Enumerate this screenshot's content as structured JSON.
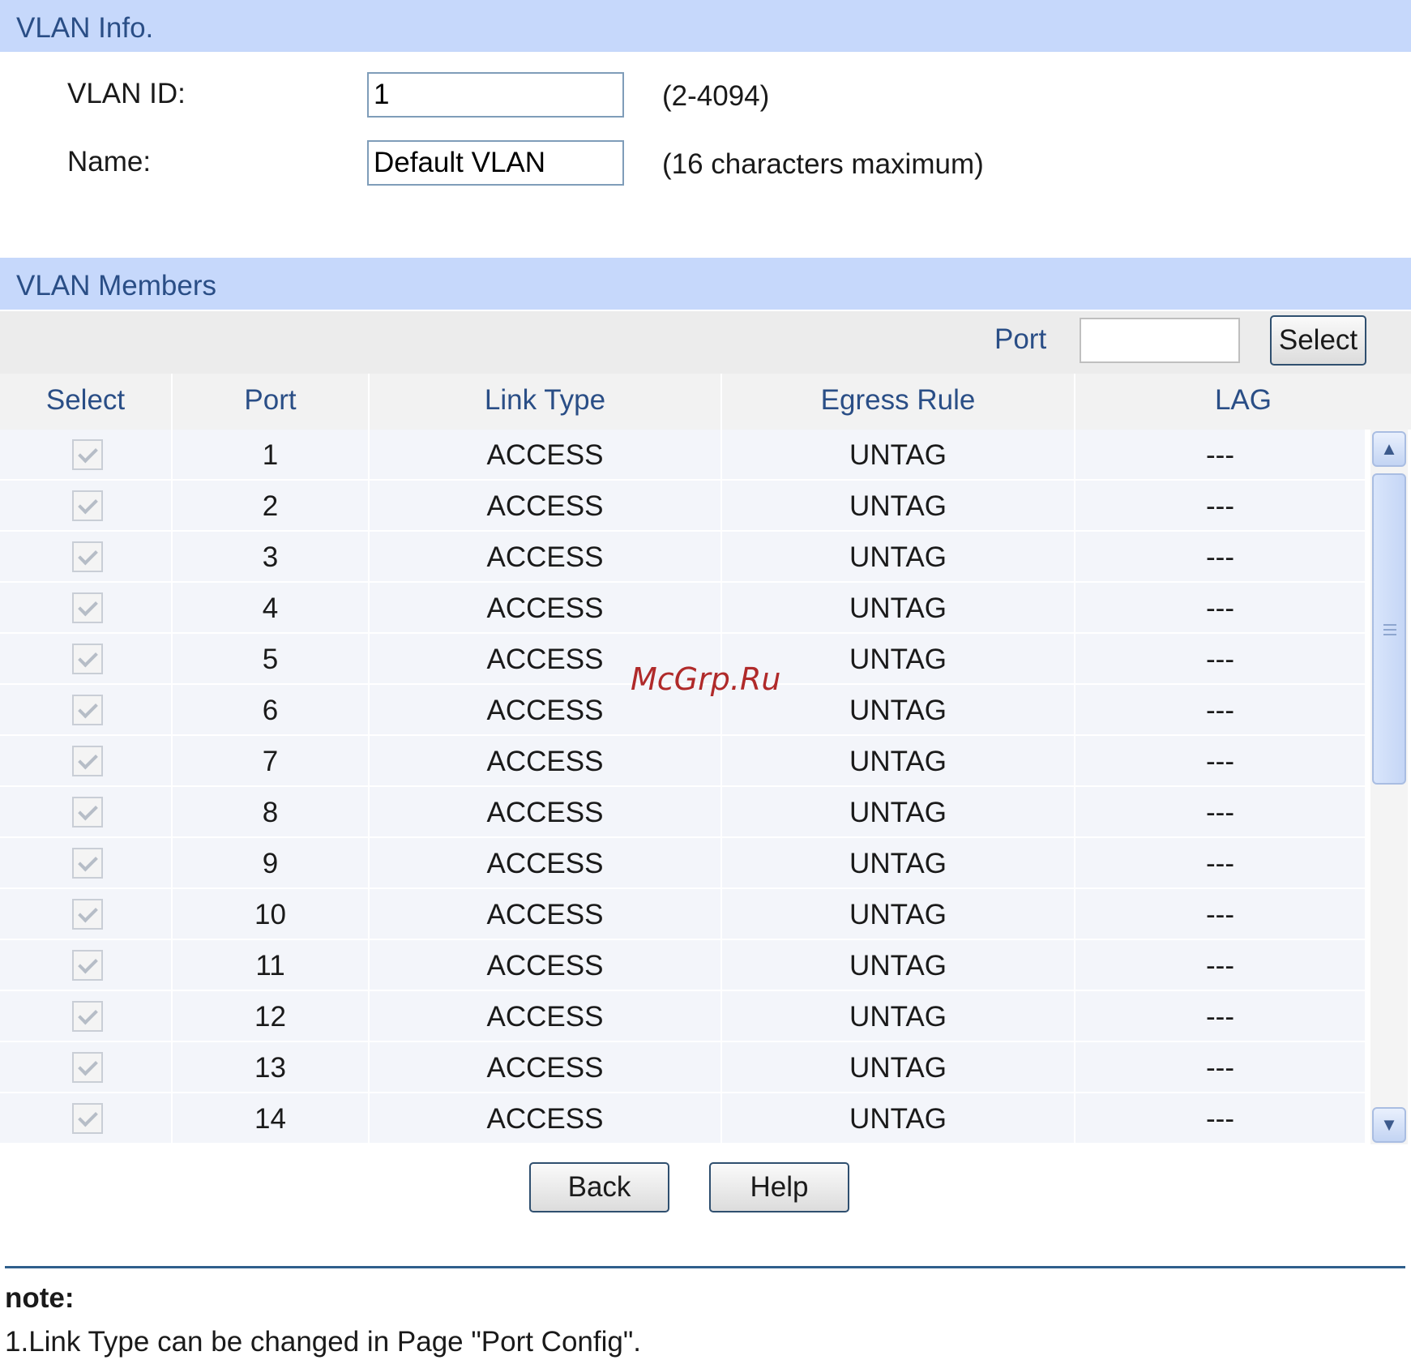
{
  "vlan_info": {
    "header": "VLAN Info.",
    "vlan_id_label": "VLAN ID:",
    "vlan_id_value": "1",
    "vlan_id_hint": "(2-4094)",
    "name_label": "Name:",
    "name_value": "Default VLAN",
    "name_hint": "(16 characters maximum)"
  },
  "vlan_members": {
    "header": "VLAN Members",
    "filter_label": "Port",
    "filter_value": "",
    "select_button": "Select",
    "columns": [
      "Select",
      "Port",
      "Link Type",
      "Egress Rule",
      "LAG"
    ],
    "rows": [
      {
        "port": "1",
        "link_type": "ACCESS",
        "egress_rule": "UNTAG",
        "lag": "---",
        "selected": true
      },
      {
        "port": "2",
        "link_type": "ACCESS",
        "egress_rule": "UNTAG",
        "lag": "---",
        "selected": true
      },
      {
        "port": "3",
        "link_type": "ACCESS",
        "egress_rule": "UNTAG",
        "lag": "---",
        "selected": true
      },
      {
        "port": "4",
        "link_type": "ACCESS",
        "egress_rule": "UNTAG",
        "lag": "---",
        "selected": true
      },
      {
        "port": "5",
        "link_type": "ACCESS",
        "egress_rule": "UNTAG",
        "lag": "---",
        "selected": true
      },
      {
        "port": "6",
        "link_type": "ACCESS",
        "egress_rule": "UNTAG",
        "lag": "---",
        "selected": true
      },
      {
        "port": "7",
        "link_type": "ACCESS",
        "egress_rule": "UNTAG",
        "lag": "---",
        "selected": true
      },
      {
        "port": "8",
        "link_type": "ACCESS",
        "egress_rule": "UNTAG",
        "lag": "---",
        "selected": true
      },
      {
        "port": "9",
        "link_type": "ACCESS",
        "egress_rule": "UNTAG",
        "lag": "---",
        "selected": true
      },
      {
        "port": "10",
        "link_type": "ACCESS",
        "egress_rule": "UNTAG",
        "lag": "---",
        "selected": true
      },
      {
        "port": "11",
        "link_type": "ACCESS",
        "egress_rule": "UNTAG",
        "lag": "---",
        "selected": true
      },
      {
        "port": "12",
        "link_type": "ACCESS",
        "egress_rule": "UNTAG",
        "lag": "---",
        "selected": true
      },
      {
        "port": "13",
        "link_type": "ACCESS",
        "egress_rule": "UNTAG",
        "lag": "---",
        "selected": true
      },
      {
        "port": "14",
        "link_type": "ACCESS",
        "egress_rule": "UNTAG",
        "lag": "---",
        "selected": true
      }
    ]
  },
  "actions": {
    "back_label": "Back",
    "help_label": "Help"
  },
  "note": {
    "title": "note:",
    "line1": "1.Link Type can be changed in Page \"Port Config\"."
  },
  "watermark": "McGrp.Ru",
  "icons": {
    "scroll_up": "chevron-up-icon",
    "scroll_down": "chevron-down-icon",
    "checkbox": "checkmark-icon"
  },
  "colors": {
    "section_header_bg": "#c6d8fb",
    "section_header_text": "#2a4e86",
    "row_bg": "#f3f5fa",
    "watermark": "#b02a2a"
  }
}
